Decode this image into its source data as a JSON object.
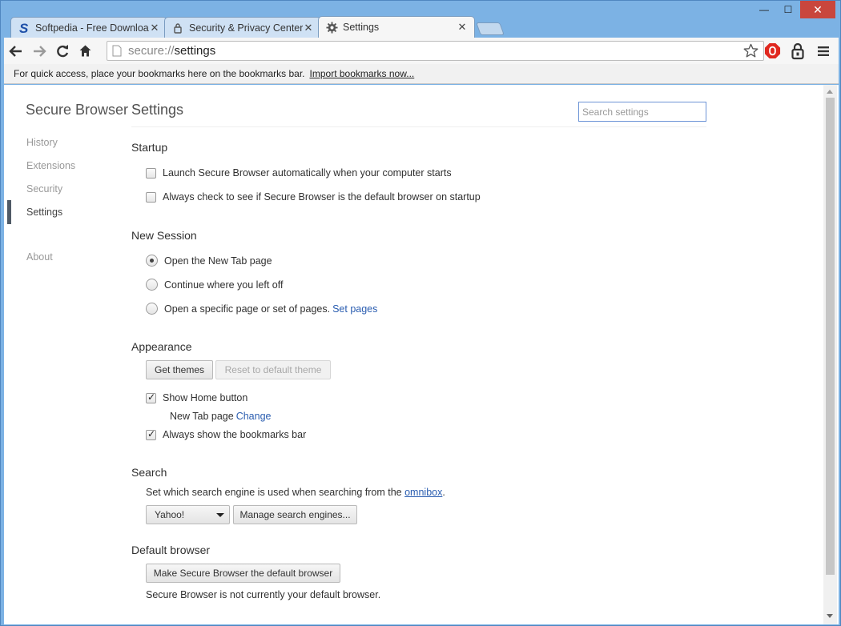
{
  "window": {
    "minimize": "—",
    "maximize": "☐",
    "close": "✕"
  },
  "tabs": [
    {
      "title": "Softpedia - Free Downloa",
      "icon": "softpedia-s-icon",
      "close": "✕"
    },
    {
      "title": "Security & Privacy Center",
      "icon": "document-lock-icon",
      "close": "✕"
    },
    {
      "title": "Settings",
      "icon": "gear-icon",
      "close": "✕"
    }
  ],
  "omnibox": {
    "scheme": "secure://",
    "path": "settings"
  },
  "bookmarks_bar": {
    "message": "For quick access, place your bookmarks here on the bookmarks bar.",
    "import_link": "Import bookmarks now..."
  },
  "sidebar": {
    "title": "Secure Browser",
    "items": [
      "History",
      "Extensions",
      "Security",
      "Settings",
      "About"
    ],
    "active": "Settings"
  },
  "settings": {
    "title": "Settings",
    "search_placeholder": "Search settings",
    "startup": {
      "heading": "Startup",
      "launch_label": "Launch Secure Browser automatically when your computer starts",
      "launch_checked": false,
      "default_check_label": "Always check to see if Secure Browser is the default browser on startup",
      "default_check_checked": false
    },
    "new_session": {
      "heading": "New Session",
      "options": [
        {
          "label": "Open the New Tab page",
          "checked": true
        },
        {
          "label": "Continue where you left off",
          "checked": false
        },
        {
          "label": "Open a specific page or set of pages.",
          "checked": false,
          "link": "Set pages"
        }
      ]
    },
    "appearance": {
      "heading": "Appearance",
      "get_themes": "Get themes",
      "reset_theme": "Reset to default theme",
      "show_home_label": "Show Home button",
      "show_home_checked": true,
      "new_tab_label": "New Tab page",
      "new_tab_link": "Change",
      "bookmarks_label": "Always show the bookmarks bar",
      "bookmarks_checked": true
    },
    "search": {
      "heading": "Search",
      "description": "Set which search engine is used when searching from the",
      "omnibox_link": "omnibox",
      "period": ".",
      "engine": "Yahoo!",
      "manage_button": "Manage search engines..."
    },
    "default_browser": {
      "heading": "Default browser",
      "make_default_button": "Make Secure Browser the default browser",
      "status": "Secure Browser is not currently your default browser."
    }
  }
}
